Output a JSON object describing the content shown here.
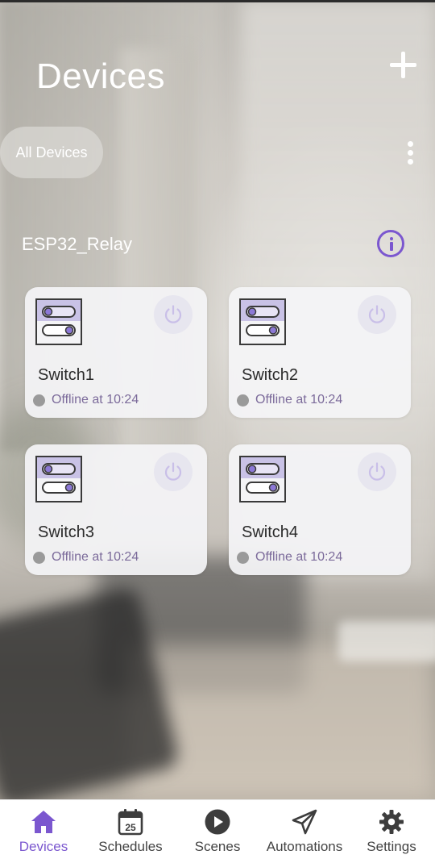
{
  "header": {
    "title": "Devices",
    "add_icon": "plus-icon"
  },
  "filter": {
    "selected": "All Devices",
    "more_icon": "more-vertical-icon"
  },
  "node": {
    "name": "ESP32_Relay",
    "info_icon": "info-icon"
  },
  "devices": [
    {
      "name": "Switch1",
      "status": "Offline at 10:24",
      "icon": "switch-icon",
      "power_icon": "power-icon"
    },
    {
      "name": "Switch2",
      "status": "Offline at 10:24",
      "icon": "switch-icon",
      "power_icon": "power-icon"
    },
    {
      "name": "Switch3",
      "status": "Offline at 10:24",
      "icon": "switch-icon",
      "power_icon": "power-icon"
    },
    {
      "name": "Switch4",
      "status": "Offline at 10:24",
      "icon": "switch-icon",
      "power_icon": "power-icon"
    }
  ],
  "nav": {
    "active": "Devices",
    "items": [
      {
        "label": "Devices",
        "icon": "home-icon"
      },
      {
        "label": "Schedules",
        "icon": "calendar-icon",
        "badge": "25"
      },
      {
        "label": "Scenes",
        "icon": "play-icon"
      },
      {
        "label": "Automations",
        "icon": "send-icon"
      },
      {
        "label": "Settings",
        "icon": "gear-icon"
      }
    ]
  },
  "colors": {
    "accent": "#7b57cf",
    "offline_dot": "#9a9a9a",
    "status_text": "#7b6a9a",
    "card_bg": "#f4f4f6",
    "switch_icon_fill": "#c9c2e6"
  }
}
